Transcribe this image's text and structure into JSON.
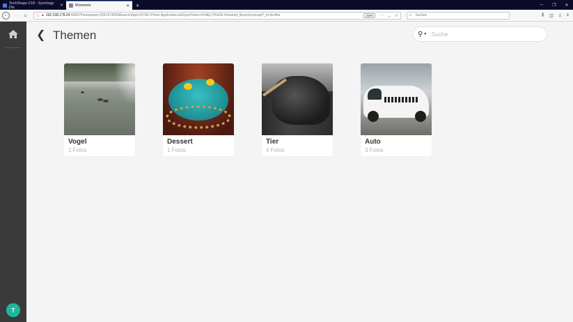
{
  "browser": {
    "tabs": [
      {
        "title": "TechStage-218 - Synology Dis",
        "active": false
      },
      {
        "title": "Moments",
        "active": true
      }
    ],
    "new_tab": "+",
    "url_host": "192.168.178.24",
    "url_rest": ":5000/?timestamp=1551974009&launchApp=SYNO.Photo.AppInstance&SynoToken=rOdEyTHIsDk.#/shared_library/concept?_k=dxr4ke",
    "zoom": "150%",
    "search_placeholder": "Suchen"
  },
  "app": {
    "page_title": "Themen",
    "search_placeholder": "Suche",
    "user_initial": "T",
    "accent_color": "#1fb69b"
  },
  "albums": [
    {
      "name": "Vogel",
      "count": "1 Fotos"
    },
    {
      "name": "Dessert",
      "count": "1 Fotos"
    },
    {
      "name": "Tier",
      "count": "4 Fotos"
    },
    {
      "name": "Auto",
      "count": "3 Fotos"
    }
  ]
}
